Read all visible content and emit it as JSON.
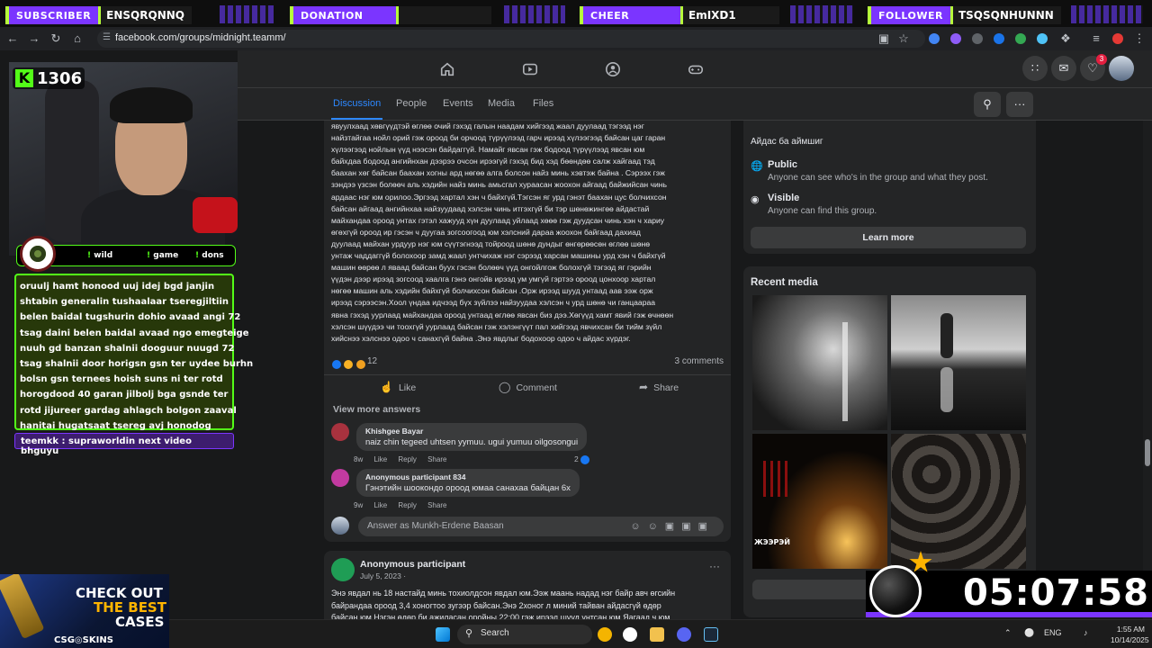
{
  "stream": {
    "alerts": [
      {
        "tag": "SUBSCRIBER",
        "name": "ENSQRQNNQ"
      },
      {
        "tag": "DONATION",
        "name": ""
      },
      {
        "tag": "CHEER",
        "name": "EmIXD1"
      },
      {
        "tag": "FOLLOWER",
        "name": "TSQSQNHUNNN"
      }
    ],
    "kick_count": "1306",
    "kick_logo": "K",
    "chat_commands": [
      "wild",
      "game",
      "dons"
    ],
    "chat_lines": [
      "oruulj hamt honood uuj idej bgd janjin",
      "shtabin generalin tushaalaar tseregjiltiin",
      "belen baidal tugshurin dohio avaad angi 72",
      "tsag daini belen baidal avaad ngo emegteige",
      "nuuh gd banzan shalnii dooguur nuugd 72",
      "tsag shalnii door horigsn gsn ter uydee burhn",
      "bolsn gsn ternees hoish suns ni ter rotd",
      "horogdood 40 garan jilbolj bga gsnde ter",
      "rotd jijureer gardag ahlagch bolgon zaaval",
      "hanitai hugatsaat tsereg avj honodog"
    ],
    "chat_message": "teemkk : supraworldin next video bhguyu",
    "timer": "05:07:58",
    "ad": {
      "line1": "CHECK OUT",
      "line2": "THE BEST",
      "line3": "CASES",
      "brand": "CSG◎SKINS"
    }
  },
  "browser": {
    "url": "facebook.com/groups/midnight.teamm/"
  },
  "fb": {
    "notification_count": "3",
    "tabs": [
      "Discussion",
      "People",
      "Events",
      "Media",
      "Files"
    ],
    "post": {
      "lines": [
        "явуулхаад хөвгүүдтэй өглөө очий гэхэд галын наадам хийгээд жаал дуулаад тэгээд нэг",
        "найзтайгаа нойл орий гэж ороод би орчоод түрүүлээд гарч ирээд хүлээгээд байсан цаг гаран",
        "хүлээгээд нойлын үүд нээсэн байдаггүй. Намайг явсан гэж бодоод  түрүүлээд явсан юм",
        "байхдаа бодоод ангийнхан дээрээ очсон ирээгүй гэхэд  бид хэд бөөндөө салж хайгаад тэд",
        "баахан хөг байсан баахан хогны ард нөгөө алга болсон найз минь хэвтэж байна . Сэрээх гэж",
        "зэндээ үзсэн болөөч аль хэдийн найз минь амьсгал хураасан жоохон айгаад байжийсан чинь",
        "ардаас нэг юм орилоо.Эргээд хартал хэн ч байхгүй.Тэгсэн яг урд гэнэт  баахан цус болчихсон",
        "байсан айгаад ангийнхаа найзуудаад хэлсэн чинь итгэхгүй би тэр шөнөжингөө айдастай",
        "майхандаа ороод унтах гэтэл хажууд хүн дуулаад уйлаад хөөө гэж дуудсан чинь хэн ч хариу",
        "өгөхгүй ороод ир гэсэн ч дуугаа зогсоогоод юм хэлсний дараа жоохон байгаад дахиад",
        "дуулаад майхан урдуур нэг юм сүүтэгнээд тойроод шөнө дундыг өнгөрөөсөн өглөө шөнө",
        "унтаж чаддаггүй болохоор замд жаал унтчихаж нэг сэрээд харсан машины урд хэн ч байхгүй",
        "машин өөрөө л яваад байсан буух гэсэн  болөөч үүд онгойлгож болохгүй тэгээд яг гэрийн",
        "үүдэн дээр ирээд зогсоод хаалга гэнэ  онгойв ирээд ум умгүй гэртээ ороод цонхоор хартал",
        "нөгөө машин аль хэдийн байхгүй болчихсон байсан .Орж ирээд шууд унтаад аав ээж орж",
        "ирээд сэрээсэн.Хоол үндаа идчээд бүх зүйлээ найзуудаа хэлсэн ч урд шөнө  чи ганцаараа",
        "явна  гэхэд уурлаад майхандаа ороод унтаад өглөө  явсан биз дээ.Хөгүүд хамт явий гэж өчнөөн",
        "хэлсэн шүүдээ чи тоохгүй уурлаад байсан гэж хэлэнгүүт пал хийгээд явчихсан би тийм зүйл",
        "хийснээ хэлснээ одоо ч санахгүй байна .Энэ явдлыг бодохоор одоо ч айдас хүрдэг."
      ],
      "reaction_count": "12",
      "comments_count": "3 comments",
      "like": "Like",
      "comment": "Comment",
      "share": "Share",
      "view_more": "View more answers",
      "comments": [
        {
          "name": "Khishgee Bayar",
          "text": "naiz chin tegeed uhtsen yymuu. ugui yumuu oilgosongui",
          "time": "8w",
          "like": "Like",
          "reply": "Reply",
          "share": "Share",
          "likes": "2"
        },
        {
          "name": "Anonymous participant 834",
          "text": "Гэнэтийн шоокондо ороод юмаа санахаа байцан 6х",
          "time": "9w",
          "like": "Like",
          "reply": "Reply",
          "share": "Share",
          "likes": ""
        }
      ],
      "answer_placeholder": "Answer as Munkh-Erdene Baasan"
    },
    "post2": {
      "author": "Anonymous participant",
      "date": "July 5, 2023 ·",
      "lines": [
        "Энэ явдал нь 18 настайд минь тохиолдсон явдал юм.Ээж маань надад нэг байр авч өгсийн",
        "байрандаа ороод 3,4 хоногтоо зугээр байсан.Энэ 2хоног л миний тайван айдасгүй өдөр",
        "байсан юм.Нэгэн өдөр би ажиласан оройны 22:00 гэж ирээд шууд унтсан юм.Яагаад ч юм"
      ]
    },
    "about": {
      "top_line": "Айдас ба аймшиг",
      "public_title": "Public",
      "public_desc": "Anyone can see who's in the group and what they post.",
      "visible_title": "Visible",
      "visible_desc": "Anyone can find this group.",
      "learn_more": "Learn more"
    },
    "media_title": "Recent media",
    "media_caption": "ЖЭЭРЭЙ"
  },
  "taskbar": {
    "search": "Search",
    "lang": "ENG",
    "time": "1:55 AM",
    "date": "10/14/2025"
  }
}
